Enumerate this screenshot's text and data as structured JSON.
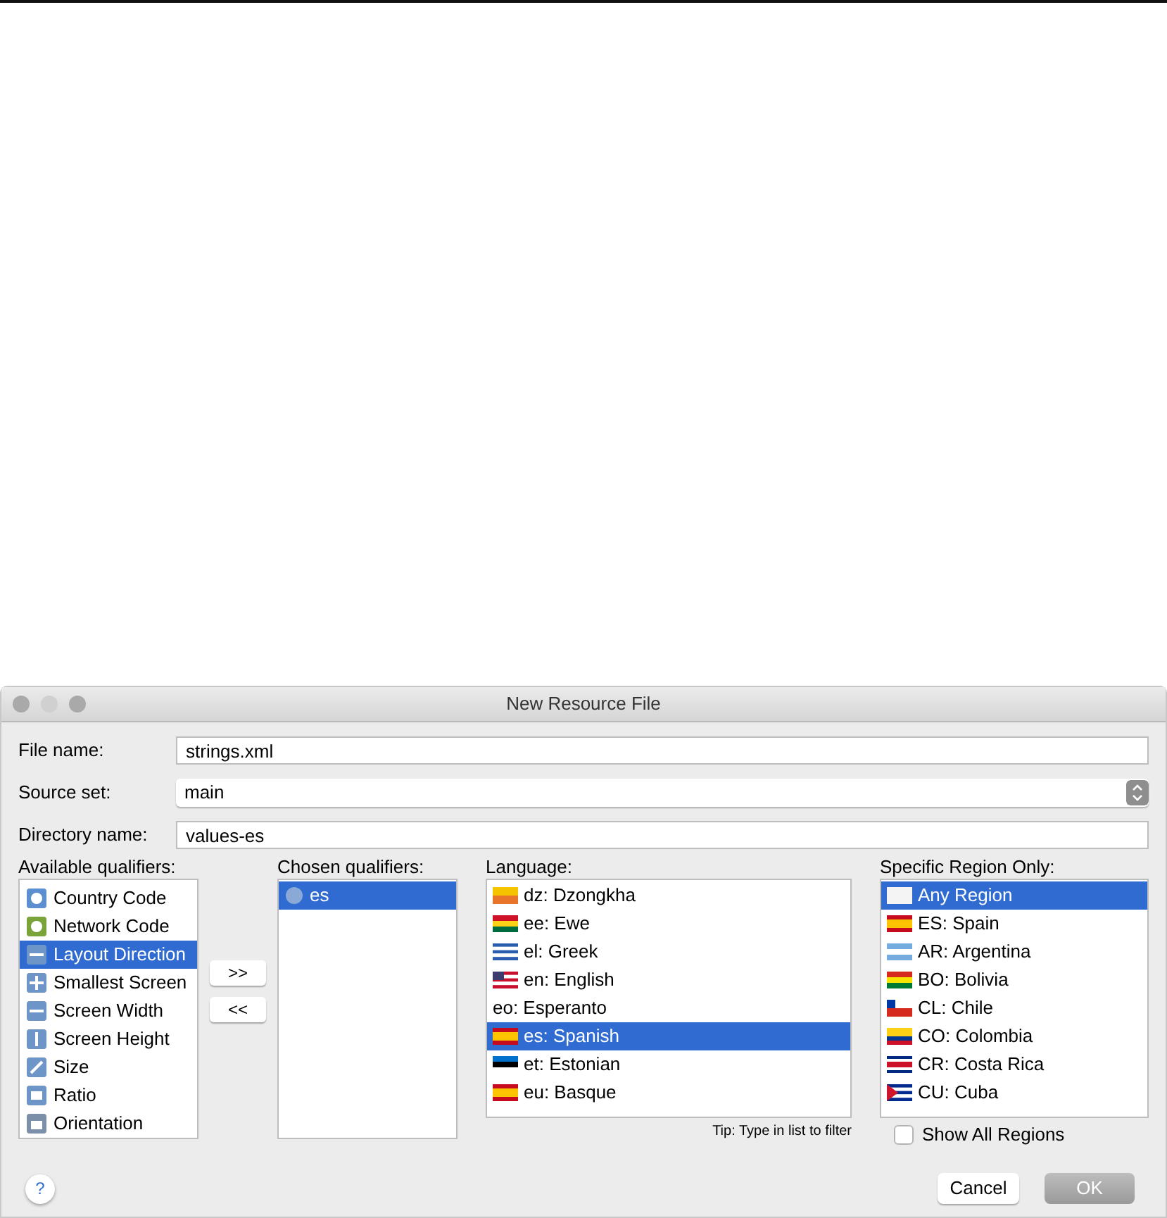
{
  "window": {
    "title": "New Resource File"
  },
  "fields": [
    {
      "label": "File name:",
      "value": "strings.xml",
      "kind": "text"
    },
    {
      "label": "Source set:",
      "value": "main",
      "kind": "select"
    },
    {
      "label": "Directory name:",
      "value": "values-es",
      "kind": "text"
    }
  ],
  "available": {
    "label": "Available qualifiers:",
    "items": [
      {
        "label": "Country Code",
        "selected": false
      },
      {
        "label": "Network Code",
        "selected": false
      },
      {
        "label": "Layout Direction",
        "selected": true
      },
      {
        "label": "Smallest Screen",
        "selected": false
      },
      {
        "label": "Screen Width",
        "selected": false
      },
      {
        "label": "Screen Height",
        "selected": false
      },
      {
        "label": "Size",
        "selected": false
      },
      {
        "label": "Ratio",
        "selected": false
      },
      {
        "label": "Orientation",
        "selected": false
      }
    ]
  },
  "move_buttons": [
    ">>",
    "<<"
  ],
  "chosen": {
    "label": "Chosen qualifiers:",
    "items": [
      {
        "label": "es",
        "selected": true
      }
    ]
  },
  "language": {
    "label": "Language:",
    "items": [
      {
        "label": "dz: Dzongkha",
        "selected": false
      },
      {
        "label": "ee: Ewe",
        "selected": false
      },
      {
        "label": "el: Greek",
        "selected": false
      },
      {
        "label": "en: English",
        "selected": false
      },
      {
        "label": "eo: Esperanto",
        "selected": false
      },
      {
        "label": "es: Spanish",
        "selected": true
      },
      {
        "label": "et: Estonian",
        "selected": false
      },
      {
        "label": "eu: Basque",
        "selected": false
      }
    ],
    "tip": "Tip: Type in list to filter"
  },
  "region": {
    "label": "Specific Region Only:",
    "items": [
      {
        "label": "Any Region",
        "selected": true
      },
      {
        "label": "ES: Spain",
        "selected": false
      },
      {
        "label": "AR: Argentina",
        "selected": false
      },
      {
        "label": "BO: Bolivia",
        "selected": false
      },
      {
        "label": "CL: Chile",
        "selected": false
      },
      {
        "label": "CO: Colombia",
        "selected": false
      },
      {
        "label": "CR: Costa Rica",
        "selected": false
      },
      {
        "label": "CU: Cuba",
        "selected": false
      }
    ]
  },
  "show_all_regions": {
    "label": "Show All Regions",
    "checked": false
  },
  "help": "?",
  "buttons": [
    {
      "label": "Cancel",
      "disabled": false
    },
    {
      "label": "OK",
      "disabled": true
    }
  ]
}
